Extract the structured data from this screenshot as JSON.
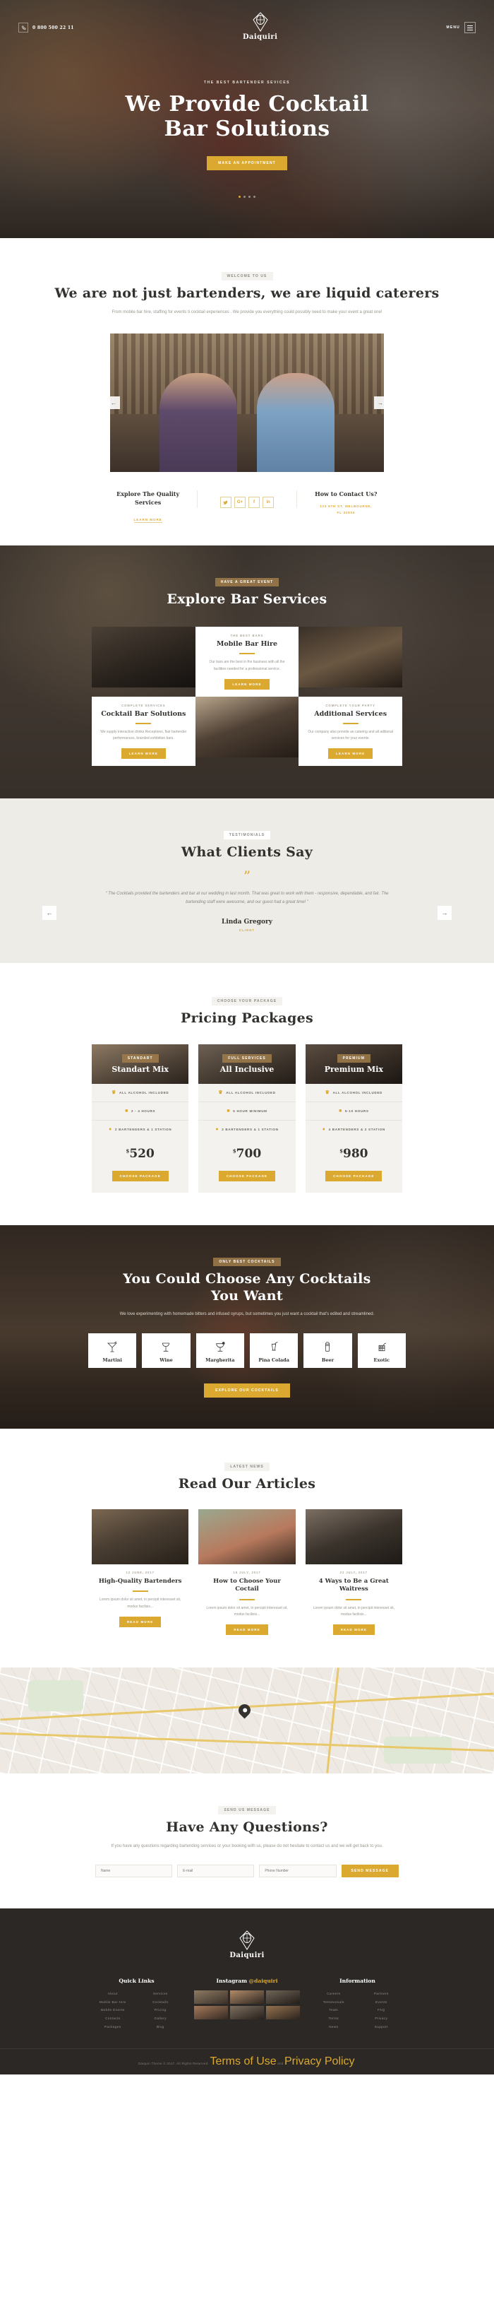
{
  "brand": {
    "name": "Daiquiri",
    "mark_icon": "diamond-emblem-icon"
  },
  "header": {
    "phone": "0 800 500 22 11",
    "phone_icon": "phone-icon",
    "menu_label": "MENU",
    "menu_icon": "hamburger-icon"
  },
  "hero": {
    "eyebrow": "THE BEST BARTENDER SEVICES",
    "title_line1": "We Provide Cocktail",
    "title_line2": "Bar Solutions",
    "cta": "MAKE AN APPOINTMENT",
    "dots": 4,
    "active_dot": 1
  },
  "about": {
    "tag": "WELCOME TO US",
    "title": "We are not just bartenders, we are liquid caterers",
    "subtitle": "From mobile bar hire, staffing for events ti cocktail experiences . We provide  you everything could possibly need to make your event a great one!",
    "prev_icon": "arrow-left-icon",
    "next_icon": "arrow-right-icon",
    "left_heading": "Explore The Quality Services",
    "left_link": "LEARN MORE",
    "socials": [
      {
        "name": "twitter-icon",
        "glyph": "✉"
      },
      {
        "name": "google-plus-icon",
        "glyph": "G+"
      },
      {
        "name": "facebook-icon",
        "glyph": "f"
      },
      {
        "name": "linkedin-icon",
        "glyph": "in"
      }
    ],
    "right_heading": "How to Contact Us?",
    "address_line1": "123 6TH ST. MELBOURNE,",
    "address_line2": "FL 32904"
  },
  "services": {
    "tag": "HAVE A GREAT EVENT",
    "title": "Explore Bar Services",
    "cards": [
      {
        "eyebrow": "THE BEST BARS",
        "title": "Mobile Bar Hire",
        "text": "Our bars are the best in the business with all the facilities needed for a professional service.",
        "cta": "LEARN MORE"
      },
      {
        "eyebrow": "COMPLETE SERVICES",
        "title": "Cocktail Bar Solutions",
        "text": "We supply interactive drinks Receptions, flair bartender performances, branded exhibition bars.",
        "cta": "LEARN MORE"
      },
      {
        "eyebrow": "COMPLETE YOUR PARTY",
        "title": "Additional Services",
        "text": "Our company also provide an catering and all aditional services for your events.",
        "cta": "LEARN MORE"
      }
    ]
  },
  "testimonials": {
    "tag": "TESTIMONIALS",
    "title": "What Clients Say",
    "quote_icon": "quote-mark-icon",
    "quote": "“ The Cocktails provided the bartenders and bar at our wedding in last month.  That was great to work with them - responsive, dependable, and fair.  The bartending staff were awesome, and our guest had a great time! ”",
    "author": "Linda Gregory",
    "role": "CLIENT",
    "prev_icon": "arrow-left-icon",
    "next_icon": "arrow-right-icon"
  },
  "pricing": {
    "tag": "CHOOSE YOUR PACKAGE",
    "title": "Pricing Packages",
    "packages": [
      {
        "badge": "STANDART",
        "name": "Standart Mix",
        "features": [
          {
            "icon": "bottle-icon",
            "label": "ALL ALCOHOL INCLUDED"
          },
          {
            "icon": "calendar-icon",
            "label": "2 - 4 HOURS"
          },
          {
            "icon": "cocktail-icon",
            "label": "2 BARTENDERS & 1 STATION"
          }
        ],
        "currency": "$",
        "price": "520",
        "cta": "CHOOSE PACKAGE"
      },
      {
        "badge": "FULL SERVICES",
        "name": "All Inclusive",
        "features": [
          {
            "icon": "bottle-icon",
            "label": "ALL ALCOHOL INCLUDED"
          },
          {
            "icon": "calendar-icon",
            "label": "5 HOUR MINIMUM"
          },
          {
            "icon": "cocktail-icon",
            "label": "2 BARTENDERS & 1 STATION"
          }
        ],
        "currency": "$",
        "price": "700",
        "cta": "CHOOSE PACKAGE"
      },
      {
        "badge": "PREMIUM",
        "name": "Premium Mix",
        "features": [
          {
            "icon": "bottle-icon",
            "label": "ALL ALCOHOL INCLUDED"
          },
          {
            "icon": "calendar-icon",
            "label": "5-10 HOURS"
          },
          {
            "icon": "cocktail-icon",
            "label": "4 BARTENDERS & 2 STATION"
          }
        ],
        "currency": "$",
        "price": "980",
        "cta": "CHOOSE PACKAGE"
      }
    ]
  },
  "cocktails": {
    "tag": "ONLY BEST COCKTAILS",
    "title_line1": "You Could Choose Any Cocktails",
    "title_line2": "You Want",
    "subtitle": "We love experimenting with homemade bitters and infused syrups, but sometimes you just want a cocktail that's edited and streamlined.",
    "items": [
      {
        "icon": "martini-glass-icon",
        "label": "Martini"
      },
      {
        "icon": "wine-glass-icon",
        "label": "Wine"
      },
      {
        "icon": "margherita-glass-icon",
        "label": "Margherita"
      },
      {
        "icon": "pina-colada-glass-icon",
        "label": "Pina Colada"
      },
      {
        "icon": "beer-glass-icon",
        "label": "Beer"
      },
      {
        "icon": "exotic-glass-icon",
        "label": "Exotic"
      }
    ],
    "cta": "EXPLORE OUR COCKTAILS"
  },
  "blog": {
    "tag": "LATEST NEWS",
    "title": "Read Our Articles",
    "posts": [
      {
        "date": "12 JUNE, 2017",
        "date_icon": "calendar-icon",
        "title": "High-Quality Bartenders",
        "excerpt": "Lorem ipsum dolor sit amet, in percipit interesset sit, modus facilisis...",
        "cta": "READ MORE"
      },
      {
        "date": "15 JULY, 2017",
        "date_icon": "calendar-icon",
        "title": "How to Choose Your Coctail",
        "excerpt": "Lorem ipsum dolor sit amet, in percipit interesset sit, modus facilisis...",
        "cta": "READ MORE"
      },
      {
        "date": "22 JULY, 2017",
        "date_icon": "calendar-icon",
        "title": "4 Ways to Be a Great Waitress",
        "excerpt": "Lorem ipsum dolor sit amet, in percipit interesset sit, modus facilisis...",
        "cta": "READ MORE"
      }
    ]
  },
  "map": {
    "pin_icon": "map-pin-icon"
  },
  "contact": {
    "tag": "SEND US MESSAGE",
    "title": "Have Any Questions?",
    "subtitle": "If you have any questions regarding bartending services or your booking with us, please do not hesitate to contact us and we will get back to you.",
    "name_placeholder": "Name",
    "email_placeholder": "E-mail",
    "phone_placeholder": "Phone Number",
    "submit_label": "SEND MESSAGE"
  },
  "footer": {
    "quick_links_title": "Quick Links",
    "quick_links": [
      "About",
      "Services",
      "Mobile Bar Hire",
      "Cocktails",
      "Mobile Events",
      "Pricing",
      "Contacts",
      "Gallery",
      "Packages",
      "Blog"
    ],
    "instagram_title": "Instagram",
    "instagram_handle": "@daiquiri",
    "instagram_tiles": 6,
    "information_title": "Information",
    "information_links": [
      "Careers",
      "Partners",
      "Testimonials",
      "Events",
      "Team",
      "FAQ",
      "Terms",
      "Privacy",
      "News",
      "Support"
    ],
    "copyright": "Daiquiri Theme © 2017. All Rights Reserved. ",
    "terms_label": "Terms of Use",
    "and_label": " and ",
    "privacy_label": "Privacy Policy",
    "period": "."
  },
  "colors": {
    "accent": "#dba92f",
    "dark": "#2b2825",
    "light_bg": "#eeece7"
  }
}
